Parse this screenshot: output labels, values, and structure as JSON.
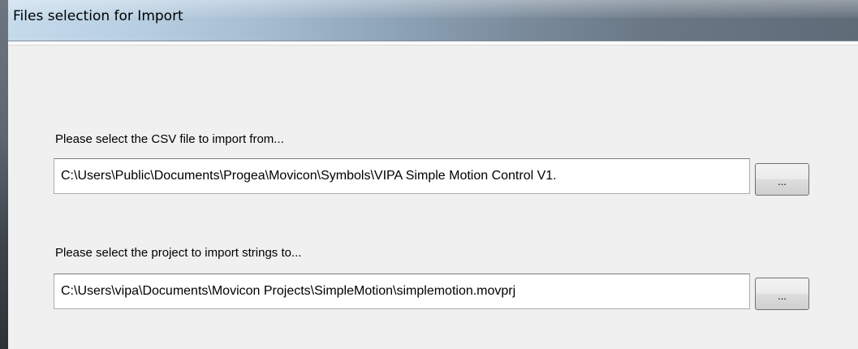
{
  "window": {
    "title": "Files selection for Import"
  },
  "csv_section": {
    "label": "Please select the CSV file to import from...",
    "path_value": "C:\\Users\\Public\\Documents\\Progea\\Movicon\\Symbols\\VIPA Simple Motion Control V1.",
    "browse_label": "..."
  },
  "project_section": {
    "label": "Please select the project to import strings to...",
    "path_value": "C:\\Users\\vipa\\Documents\\Movicon Projects\\SimpleMotion\\simplemotion.movprj",
    "browse_label": "..."
  }
}
